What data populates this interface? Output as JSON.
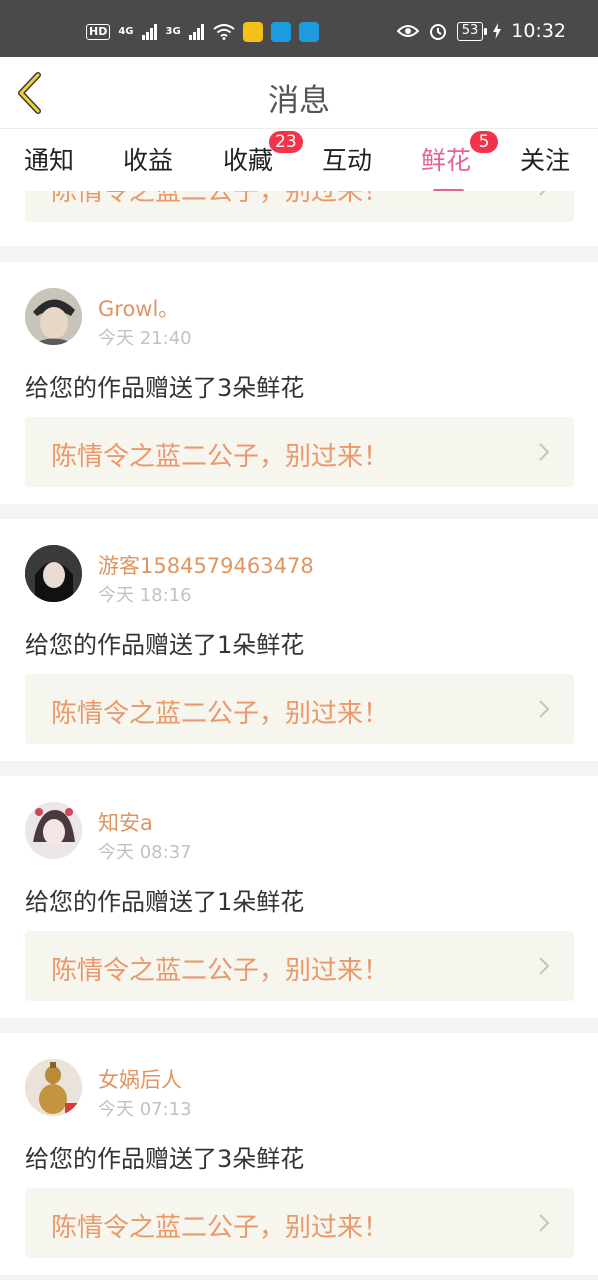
{
  "status_bar": {
    "network_hd": "HD",
    "network_1": "4G",
    "network_2": "3G",
    "battery": "53",
    "time": "10:32"
  },
  "header": {
    "title": "消息"
  },
  "tabs": [
    {
      "label": "通知"
    },
    {
      "label": "收益"
    },
    {
      "label": "收藏",
      "badge": "23"
    },
    {
      "label": "互动"
    },
    {
      "label": "鲜花",
      "badge": "5"
    },
    {
      "label": "关注"
    }
  ],
  "colors": {
    "accent": "#e8609a",
    "username": "#e0955f",
    "work_title": "#e9996a",
    "badge": "#f2334a"
  },
  "partial_card": {
    "work_title": "陈情令之蓝二公子，别过来！"
  },
  "notifications": [
    {
      "username": "Growl。",
      "time": "今天 21:40",
      "message": "给您的作品赠送了3朵鲜花",
      "work_title": "陈情令之蓝二公子，别过来！"
    },
    {
      "username": "游客1584579463478",
      "time": "今天 18:16",
      "message": "给您的作品赠送了1朵鲜花",
      "work_title": "陈情令之蓝二公子，别过来！"
    },
    {
      "username": "知安a",
      "time": "今天 08:37",
      "message": "给您的作品赠送了1朵鲜花",
      "work_title": "陈情令之蓝二公子，别过来！"
    },
    {
      "username": "女娲后人",
      "time": "今天 07:13",
      "message": "给您的作品赠送了3朵鲜花",
      "work_title": "陈情令之蓝二公子，别过来！"
    }
  ]
}
